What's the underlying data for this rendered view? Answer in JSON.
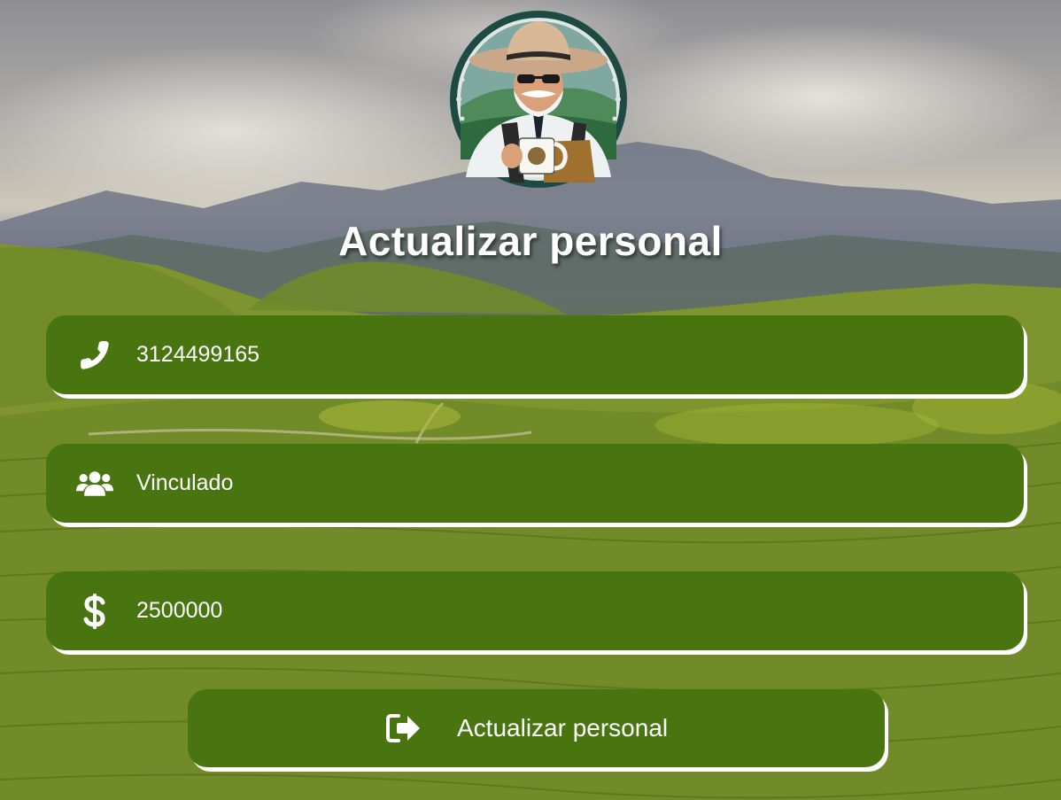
{
  "page": {
    "title": "Actualizar personal",
    "logo_icon": "farmer-coffee-logo"
  },
  "form": {
    "phone": {
      "icon": "phone-icon",
      "value": "3124499165"
    },
    "status": {
      "icon": "users-icon",
      "value": "Vinculado"
    },
    "salary": {
      "icon": "dollar-icon",
      "value": "2500000"
    },
    "submit": {
      "icon": "sign-in-icon",
      "label": "Actualizar personal"
    }
  },
  "colors": {
    "field_bg": "#497511",
    "text": "#ffffff"
  }
}
